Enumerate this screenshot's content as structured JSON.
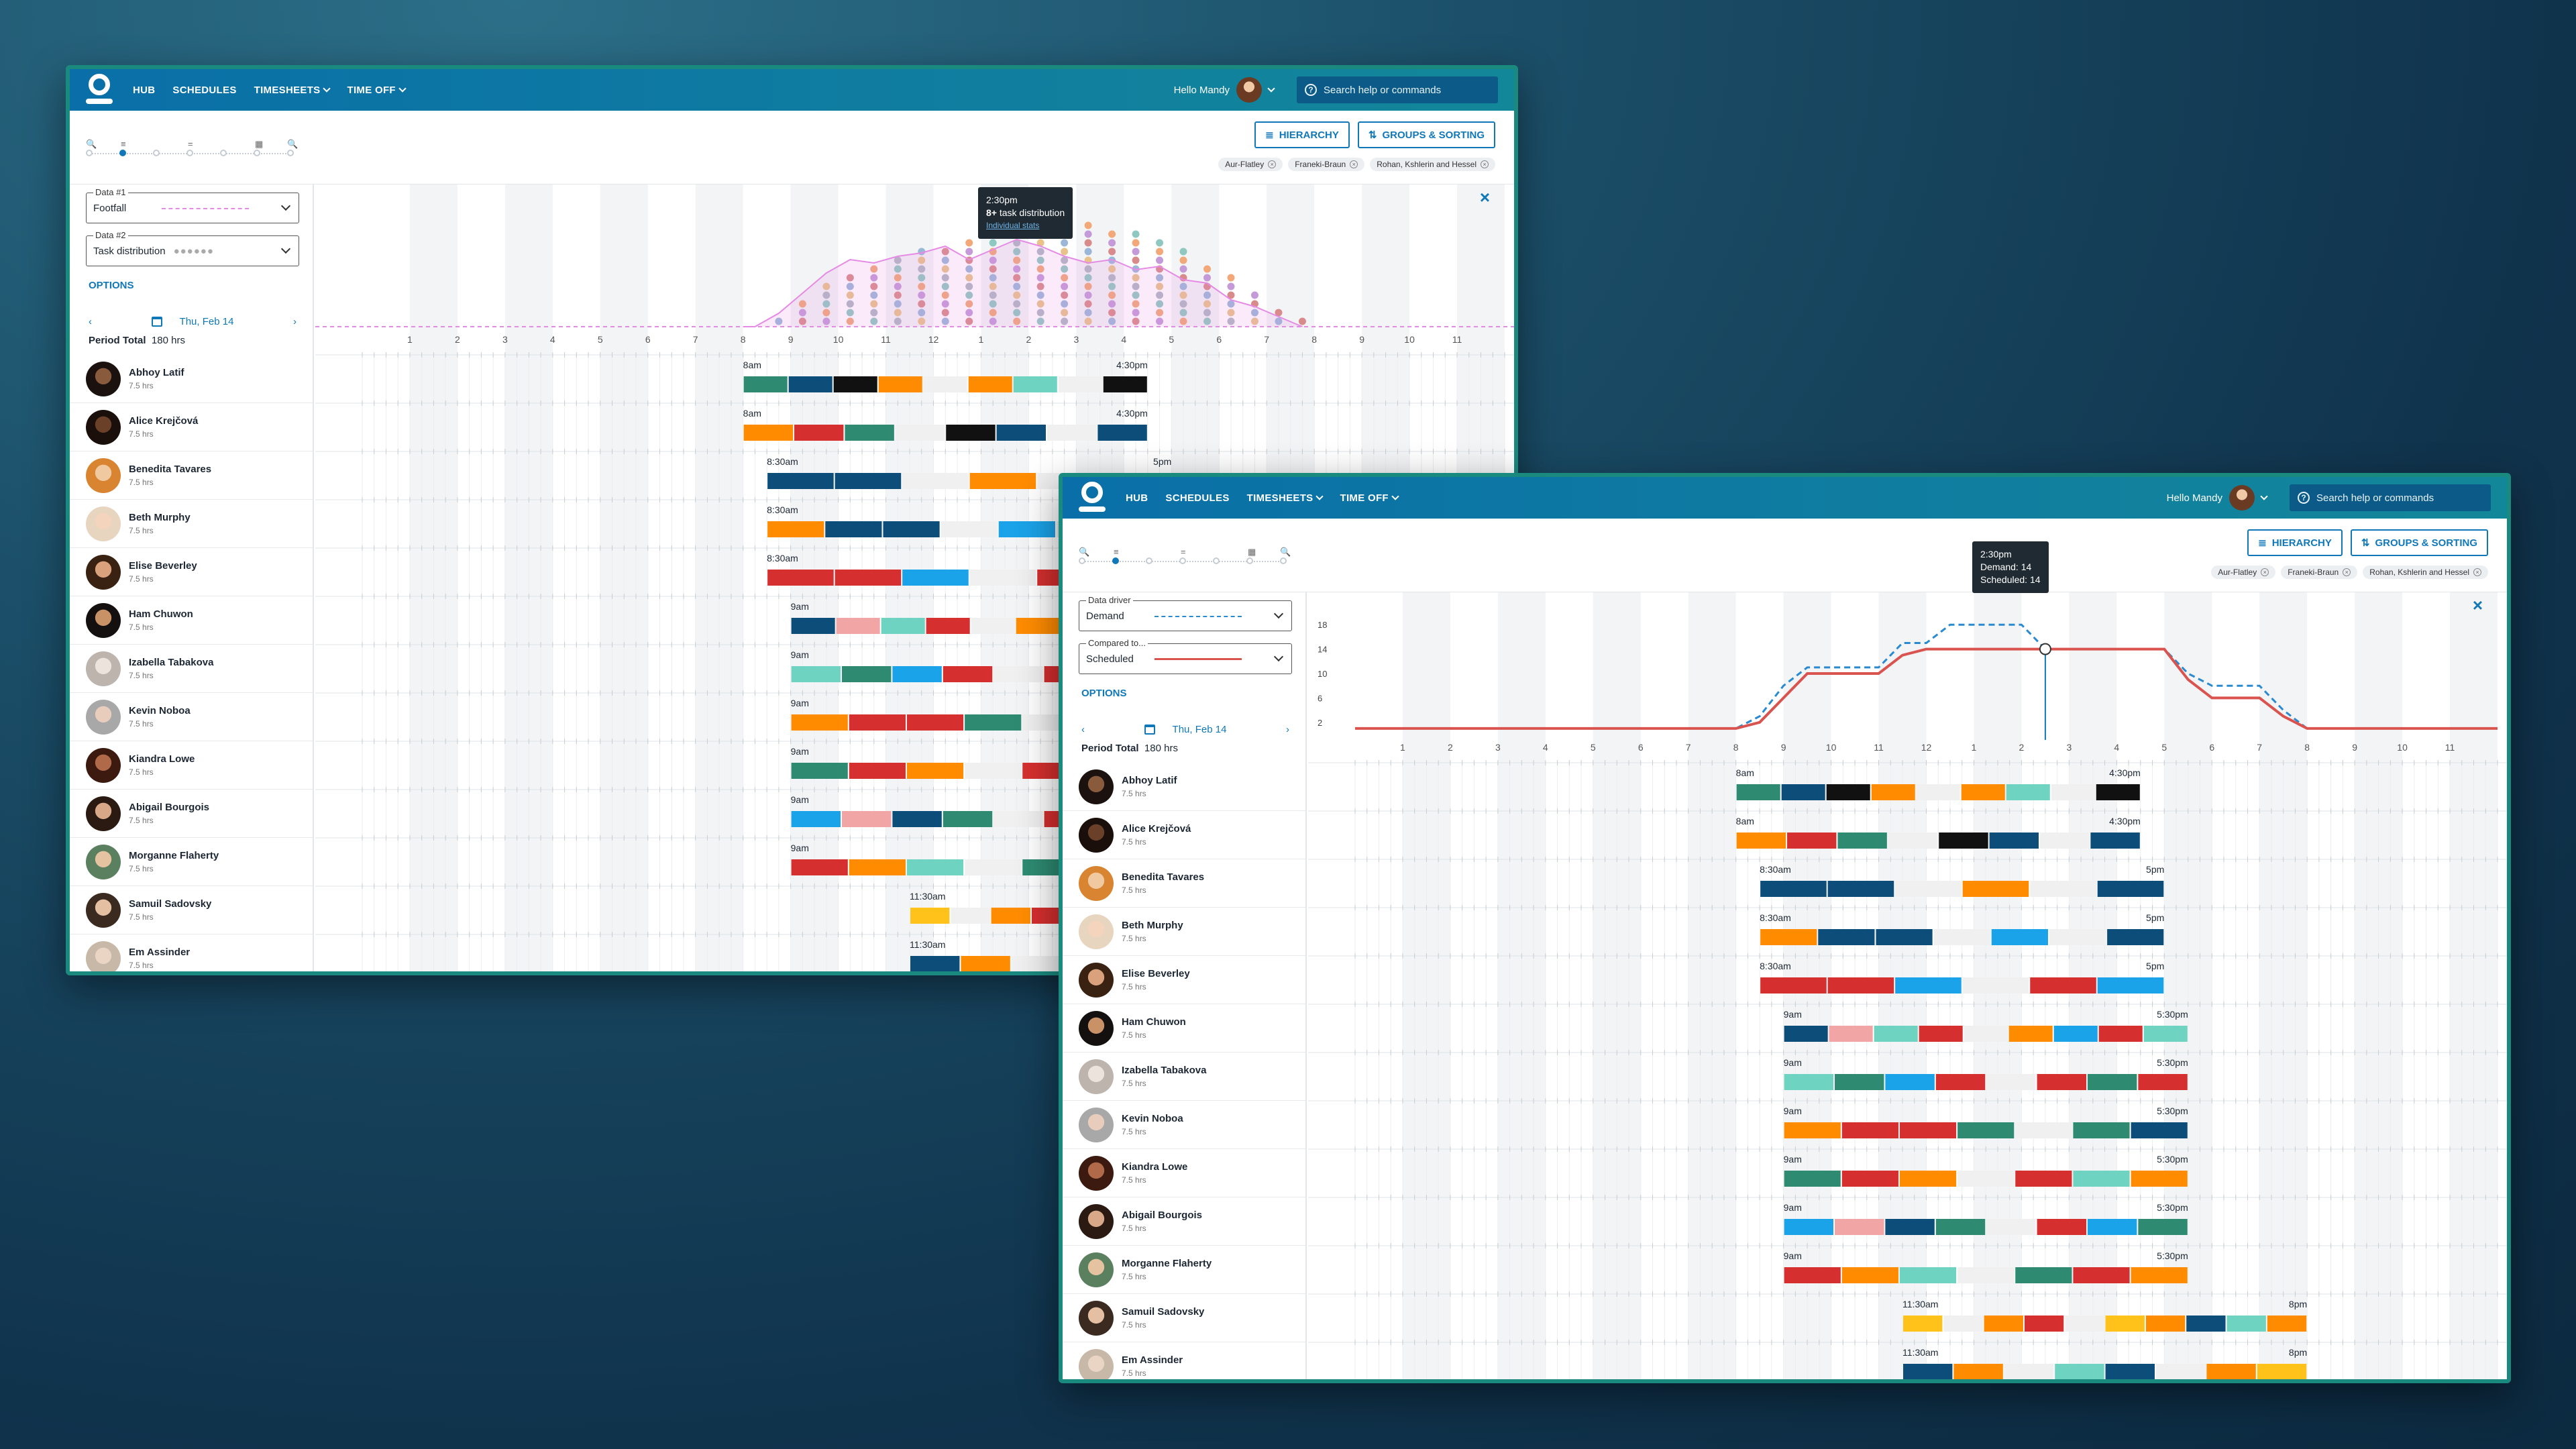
{
  "nav": {
    "hub": "HUB",
    "schedules": "SCHEDULES",
    "timesheets": "TIMESHEETS",
    "timeoff": "TIME OFF"
  },
  "user": {
    "greeting": "Hello Mandy"
  },
  "search": {
    "placeholder": "Search help or commands"
  },
  "toolbar": {
    "hierarchy": "HIERARCHY",
    "groups": "GROUPS & SORTING"
  },
  "filters": [
    "Aur-Flatley",
    "Franeki-Braun",
    "Rohan, Kshlerin and Hessel"
  ],
  "date_label": "Thu, Feb 14",
  "period_label": "Period Total",
  "period_value": "180 hrs",
  "options_label": "OPTIONS",
  "back_window": {
    "data1_label": "Data #1",
    "data1_value": "Footfall",
    "data2_label": "Data #2",
    "data2_value": "Task distribution",
    "tooltip_time": "2:30pm",
    "tooltip_bold": "8+",
    "tooltip_text": " task distribution",
    "tooltip_link": "Individual stats"
  },
  "front_window": {
    "data1_label": "Data driver",
    "data1_value": "Demand",
    "data2_label": "Compared to...",
    "data2_value": "Scheduled",
    "tooltip_time": "2:30pm",
    "tooltip_demand": "Demand: 14",
    "tooltip_scheduled": "Scheduled: 14"
  },
  "hour_ticks": [
    "1",
    "2",
    "3",
    "4",
    "5",
    "6",
    "7",
    "8",
    "9",
    "10",
    "11",
    "12",
    "1",
    "2",
    "3",
    "4",
    "5",
    "6",
    "7",
    "8",
    "9",
    "10",
    "11"
  ],
  "chart_data": {
    "type": "line",
    "x": [
      8,
      8.5,
      9,
      9.5,
      10,
      10.5,
      11,
      11.5,
      12,
      12.5,
      13,
      13.5,
      14,
      14.5,
      15,
      15.5,
      16,
      16.5,
      17,
      17.5,
      18,
      18.5,
      19,
      19.5,
      20
    ],
    "yticks": [
      2,
      6,
      10,
      14,
      18
    ],
    "ylim": [
      0,
      20
    ],
    "series": [
      {
        "name": "Demand",
        "color": "#2a8ad0",
        "values": [
          1,
          3,
          8,
          11,
          11,
          11,
          11,
          15,
          15,
          18,
          18,
          18,
          18,
          14,
          14,
          14,
          14,
          14,
          14,
          10,
          8,
          8,
          8,
          4,
          1
        ]
      },
      {
        "name": "Scheduled",
        "color": "#d9534f",
        "values": [
          1,
          2,
          6,
          10,
          10,
          10,
          10,
          13,
          14,
          14,
          14,
          14,
          14,
          14,
          14,
          14,
          14,
          14,
          14,
          9,
          6,
          6,
          6,
          3,
          1
        ]
      }
    ]
  },
  "people": [
    {
      "name": "Abhoy Latif",
      "hrs": "7.5 hrs",
      "start": "8am",
      "end": "4:30pm",
      "s": 8,
      "e": 16.5,
      "skin": "#8a5a3c",
      "hair": "#1b1210"
    },
    {
      "name": "Alice Krejčová",
      "hrs": "7.5 hrs",
      "start": "8am",
      "end": "4:30pm",
      "s": 8,
      "e": 16.5,
      "skin": "#6b4028",
      "hair": "#1a0f0a"
    },
    {
      "name": "Benedita Tavares",
      "hrs": "7.5 hrs",
      "start": "8:30am",
      "end": "5pm",
      "s": 8.5,
      "e": 17,
      "skin": "#f0c9a0",
      "hair": "#d88430"
    },
    {
      "name": "Beth Murphy",
      "hrs": "7.5 hrs",
      "start": "8:30am",
      "end": "5pm",
      "s": 8.5,
      "e": 17,
      "skin": "#f4d4bc",
      "hair": "#e8d5bf"
    },
    {
      "name": "Elise Beverley",
      "hrs": "7.5 hrs",
      "start": "8:30am",
      "end": "5pm",
      "s": 8.5,
      "e": 17,
      "skin": "#d9a27c",
      "hair": "#3a2212"
    },
    {
      "name": "Ham Chuwon",
      "hrs": "7.5 hrs",
      "start": "9am",
      "end": "5:30pm",
      "s": 9,
      "e": 17.5,
      "skin": "#c89266",
      "hair": "#151010"
    },
    {
      "name": "Izabella Tabakova",
      "hrs": "7.5 hrs",
      "start": "9am",
      "end": "5:30pm",
      "s": 9,
      "e": 17.5,
      "skin": "#ece3dc",
      "hair": "#bdb4ad"
    },
    {
      "name": "Kevin Noboa",
      "hrs": "7.5 hrs",
      "start": "9am",
      "end": "5:30pm",
      "s": 9,
      "e": 17.5,
      "skin": "#e8cdbd",
      "hair": "#a8a8a8"
    },
    {
      "name": "Kiandra Lowe",
      "hrs": "7.5 hrs",
      "start": "9am",
      "end": "5:30pm",
      "s": 9,
      "e": 17.5,
      "skin": "#b06a4a",
      "hair": "#3c1a10"
    },
    {
      "name": "Abigail Bourgois",
      "hrs": "7.5 hrs",
      "start": "9am",
      "end": "5:30pm",
      "s": 9,
      "e": 17.5,
      "skin": "#d8a888",
      "hair": "#2a1a12"
    },
    {
      "name": "Morganne Flaherty",
      "hrs": "7.5 hrs",
      "start": "9am",
      "end": "5:30pm",
      "s": 9,
      "e": 17.5,
      "skin": "#e6c3a0",
      "hair": "#5a8060"
    },
    {
      "name": "Samuil Sadovsky",
      "hrs": "7.5 hrs",
      "start": "11:30am",
      "end": "8pm",
      "s": 11.5,
      "e": 20,
      "skin": "#e4bfa2",
      "hair": "#3a2a20"
    },
    {
      "name": "Em Assinder",
      "hrs": "7.5 hrs",
      "start": "11:30am",
      "end": "8pm",
      "s": 11.5,
      "e": 20,
      "skin": "#ead4c4",
      "hair": "#c8b8a8"
    }
  ],
  "colors": {
    "accent": "#1078b8",
    "teal": "#2e8b72",
    "orange": "#ff8c00",
    "black": "#111111",
    "dark_blue": "#0d4d7a",
    "sky": "#1aa3e8",
    "red": "#d62f2f",
    "mint": "#6fd3c1",
    "pink": "#f2a5a5",
    "yellow": "#ffc21a"
  }
}
